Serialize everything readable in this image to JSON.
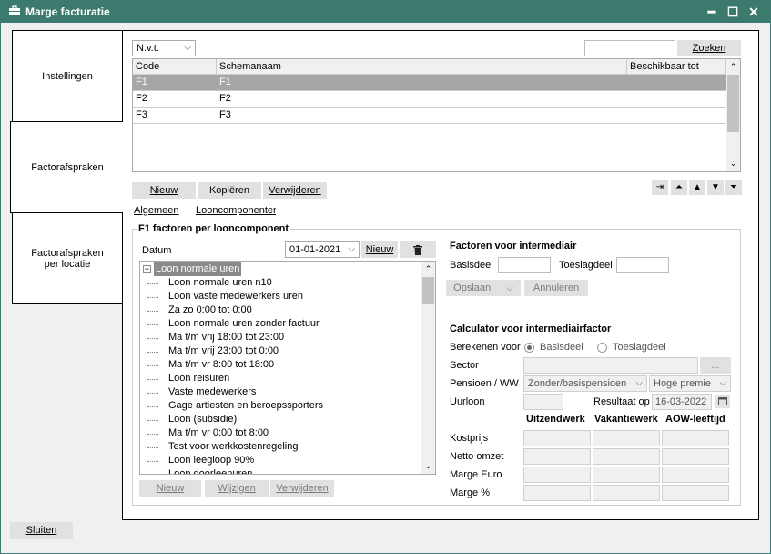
{
  "window": {
    "title": "Marge facturatie",
    "icon": "briefcase-icon",
    "minimize": "━",
    "maximize": "☐",
    "close": "✕"
  },
  "sidebar": {
    "items": [
      {
        "label": "Instellingen"
      },
      {
        "label": "Factorafspraken"
      },
      {
        "label": "Factorafspraken\nper locatie"
      }
    ]
  },
  "filter": {
    "selected": "N.v.t.",
    "search_value": "",
    "search_button": "Zoeken"
  },
  "schema_grid": {
    "columns": [
      "Code",
      "Schemanaam",
      "Beschikbaar tot"
    ],
    "rows": [
      {
        "code": "F1",
        "name": "F1",
        "until": ""
      },
      {
        "code": "F2",
        "name": "F2",
        "until": ""
      },
      {
        "code": "F3",
        "name": "F3",
        "until": ""
      }
    ]
  },
  "schema_actions": {
    "new": "Nieuw",
    "copy": "Kopiëren",
    "delete": "Verwijderen"
  },
  "nav_buttons": {
    "export": "⇥",
    "top": "⏶",
    "up": "▲",
    "down": "▼",
    "bottom": "⏷"
  },
  "subtabs": {
    "general": "Algemeen",
    "components": "Looncomponenten"
  },
  "group": {
    "title": "F1 factoren per looncomponent",
    "date_label": "Datum",
    "date_value": "01-01-2021",
    "new_date": "Nieuw",
    "tree": {
      "root": "Loon normale uren",
      "children": [
        "Loon normale uren n10",
        "Loon vaste medewerkers uren",
        "Za zo 0:00 tot 0:00",
        "Loon normale uren zonder factuur",
        "Ma t/m vrij 18:00 tot 23:00",
        "Ma t/m vrij 23:00 tot 0:00",
        "Ma t/m vr 8:00 tot 18:00",
        "Loon reisuren",
        "Vaste medewerkers",
        "Gage artiesten en beroepssporters",
        "Loon (subsidie)",
        "Ma t/m vr 0:00 tot 8:00",
        "Test voor werkkostenregeling",
        "Loon leegloop 90%",
        "Loon doorleenuren"
      ]
    },
    "tree_actions": {
      "new": "Nieuw",
      "edit": "Wijzigen",
      "delete": "Verwijderen"
    }
  },
  "factors": {
    "title": "Factoren voor intermediair",
    "base_label": "Basisdeel",
    "base_value": "",
    "extra_label": "Toeslagdeel",
    "extra_value": "",
    "save": "Opslaan",
    "cancel": "Annuleren"
  },
  "calculator": {
    "title": "Calculator voor intermediairfactor",
    "calc_label": "Berekenen voor",
    "opt_base": "Basisdeel",
    "opt_extra": "Toeslagdeel",
    "sector_label": "Sector",
    "sector_value": "",
    "sector_button": "...",
    "pension_label": "Pensioen / WW",
    "pension_value": "Zonder/basispensioen",
    "premium_value": "Hoge premie",
    "hourly_label": "Uurloon",
    "hourly_value": "",
    "result_label": "Resultaat op",
    "result_value": "16-03-2022",
    "columns": [
      "Uitzendwerk",
      "Vakantiewerk",
      "AOW-leeftijd"
    ],
    "rows": [
      "Kostprijs",
      "Netto omzet",
      "Marge Euro",
      "Marge %"
    ]
  },
  "footer": {
    "close": "Sluiten"
  }
}
